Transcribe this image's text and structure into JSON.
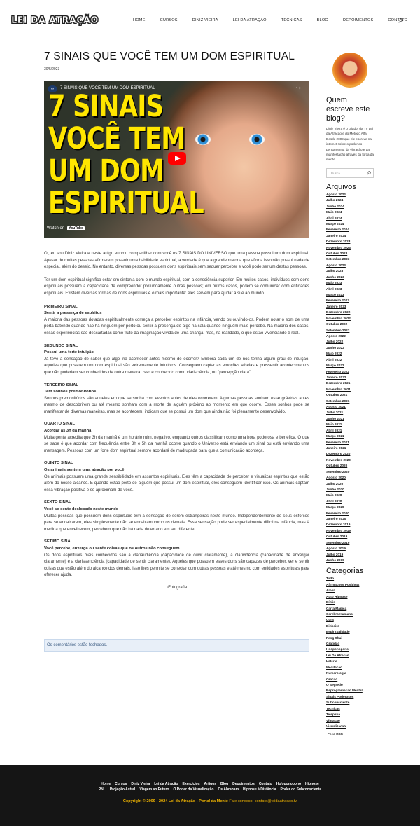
{
  "header": {
    "logo": "LEI DA ATRAÇÃO",
    "nav": [
      "HOME",
      "CURSOS",
      "DINIZ VIEIRA",
      "LEI DA ATRAÇÃO",
      "TECNICAS",
      "BLOG",
      "DEPOIMENTOS",
      "CONTATO",
      "LOGIN"
    ]
  },
  "post": {
    "title": "7 SINAIS QUE VOCÊ TEM UM DOM ESPIRITUAL",
    "date": "30/5/2023",
    "video": {
      "caption": "7 SINAIS QUE VOCÊ TEM UM DOM ESPIRITUAL",
      "overlay": "7 SINAIS VOCÊ TEM UM DOM ESPIRITUAL",
      "watch": "Watch on",
      "brand": "YouTube"
    },
    "intro": "Oi, eu sou Diniz Vieira e neste artigo eu vou compartilhar com você os 7 SINAIS DO UNIVERSO que uma pessoa possui um dom espiritual. Apesar de muitas pessoas afirmarem possuir uma habilidade espiritual, a verdade é que a grande maioria que afirma isso não possui nada de especial, além do desejo. No entanto, diversas pessoas possuem dons espirituais sem sequer perceber e você pode ser um destas pessoas.",
    "p2": "Ter um dom espiritual significa estar em sintonia com o mundo espiritual, com a consciência superior. Em muitos casos, indivíduos com dons espirituais possuem a capacidade de compreender profundamente outras pessoas; em outros casos, podem se comunicar com entidades espirituais. Existem diversas formas de dons espirituais e o mais importante: eles servem para ajudar a si e ao mundo.",
    "sections": [
      {
        "h": "PRIMEIRO SINAL",
        "s": "Sentir a presença de espíritos",
        "t": "A maioria das pessoas dotadas espiritualmente começa a perceber espíritos na infância, vendo ou ouvindo-os. Podem notar o som de uma porta batendo quando não há ninguém por perto ou sentir a presença de algo na sala quando ninguém mais percebe. Na maioria dos casos, essas experiências são descartadas como fruto da imaginação vívida de uma criança, mas, na realidade, o que estão vivenciando é real."
      },
      {
        "h": "SEGUNDO SINAL",
        "s": "Possui uma forte intuição",
        "t": "Já teve a sensação de saber que algo iria acontecer antes mesmo de ocorrer? Embora cada um de nós tenha algum grau de intuição, aqueles que possuem um dom espiritual são extremamente intuitivos. Conseguem captar as emoções alheias e pressentir acontecimentos que não poderiam ser conhecidos de outra maneira. Isso é conhecido como clarisciência, ou \"percepção clara\"."
      },
      {
        "h": "TERCEIRO SINAL",
        "s": "Tem sonhos premonitórios",
        "t": "Sonhos premonitórios são aqueles em que se sonha com eventos antes de eles ocorrerem. Algumas pessoas sonham estar grávidas antes mesmo de descobrirem ou até mesmo sonham com a morte de alguém próximo ao momento em que ocorre. Esses sonhos pode se manifestar de diversas maneiras, mas se acontecem, indicam que se possui um dom que ainda não foi plenamente desenvolvido."
      },
      {
        "h": "QUARTO SINAL",
        "s": "Acordar às 3h da manhã",
        "t": "Muita gente acredita que 3h da manhã é um horário ruim, negativo, enquanto outros classificam como uma hora poderosa e benéfica. O que se sabe é que acordar com frequência entre 3h e 5h da manhã ocorre quando o Universo está enviando um sinal ou está enviando uma mensagem. Pessoas com um forte dom espiritual sempre acordará de madrugada para que a comunicação aconteça."
      },
      {
        "h": "QUINTO SINAL",
        "s": "Os animais sentem uma atração por você",
        "t": "Os animais possuem uma grande sensibilidade em assuntos espirituais. Eles têm a capacidade de perceber e visualizar espíritos que estão além do nosso alcance. E quando estão perto de alguém que possui um dom espiritual, eles conseguem identificar isso. Os animais captam essa vibração positiva e se aproximam de você."
      },
      {
        "h": "SEXTO SINAL",
        "s": "Você se sente deslocado neste mundo",
        "t": "Muitas pessoas que possuem dons espirituais têm a sensação de serem estrangeiras neste mundo. Independentemente de seus esforços para se encaixarem, eles simplesmente não se encaixam como os demais. Essa sensação pode ser especialmente difícil na infância, mas à medida que envelhecem, percebem que não há nada de errado em ser diferente."
      },
      {
        "h": "SÉTIMO SINAL",
        "s": "Você percebe, enxerga ou sente coisas que os outros não conseguem",
        "t": "Os dons espirituais mais conhecidos são a clariaudiência (capacidade de ouvir claramente), a clarividência (capacidade de enxergar claramente) e a clarissenciência (capacidade de sentir claramente). Aqueles que possuem esses dons são capazes de perceber, ver e sentir coisas que estão além do alcance dos demais. Isso lhes permite se conectar com outras pessoas e até mesmo com entidades espirituais para oferecer ajuda."
      }
    ],
    "figure": "Fotografia",
    "comments": "Os comentários estão fechados."
  },
  "sidebar": {
    "about_title": "Quem escreve este blog?",
    "about": "Diniz Vieira é o criador da TV Lei da Atração e do Método Alfa. Desde 2009 que ele escreve na internet sobre o poder do pensamento, da vibração e da manifestação através da força da mente.",
    "search_placeholder": "Busca",
    "archives_title": "Arquivos",
    "archives": [
      "Agosto 2024",
      "Julho 2024",
      "Junho 2024",
      "Maio 2024",
      "Abril 2024",
      "Março 2024",
      "Fevereiro 2024",
      "Janeiro 2024",
      "Dezembro 2023",
      "Novembro 2023",
      "Outubro 2023",
      "Setembro 2023",
      "Agosto 2023",
      "Julho 2023",
      "Junho 2023",
      "Maio 2023",
      "Abril 2023",
      "Março 2023",
      "Fevereiro 2023",
      "Janeiro 2023",
      "Dezembro 2022",
      "Novembro 2022",
      "Outubro 2022",
      "Setembro 2022",
      "Agosto 2022",
      "Julho 2022",
      "Junho 2022",
      "Maio 2022",
      "Abril 2022",
      "Março 2022",
      "Fevereiro 2022",
      "Janeiro 2022",
      "Dezembro 2021",
      "Novembro 2021",
      "Outubro 2021",
      "Setembro 2021",
      "Agosto 2021",
      "Julho 2021",
      "Junho 2021",
      "Maio 2021",
      "Abril 2021",
      "Março 2021",
      "Fevereiro 2021",
      "Janeiro 2021",
      "Dezembro 2020",
      "Novembro 2020",
      "Outubro 2020",
      "Setembro 2020",
      "Agosto 2020",
      "Julho 2020",
      "Junho 2020",
      "Maio 2020",
      "Abril 2020",
      "Março 2020",
      "Fevereiro 2020",
      "Janeiro 2020",
      "Dezembro 2019",
      "Novembro 2019",
      "Outubro 2019",
      "Setembro 2019",
      "Agosto 2019",
      "Julho 2019",
      "Junho 2019"
    ],
    "categories_title": "Categorias",
    "categories": [
      "Tudo",
      "Afirmacoes Positivas",
      "Amor",
      "Auto Hipnose",
      "Bíblia",
      "Carta Magica",
      "Cerebro Humano",
      "Cura",
      "Dinheiro",
      "Espiritualidade",
      "Feng Shui",
      "Gratidao",
      "Hooponopono",
      "Lei Da Atracao",
      "Loteria",
      "Meditacao",
      "Numerologia",
      "Oracao",
      "O Segredo",
      "Reprogramacao Mental",
      "Sinais Poderosos",
      "Subconsciente",
      "Tecnicas",
      "Telepatia",
      "Vibracao",
      "Visualizacao"
    ],
    "feed": "Feed RSS"
  },
  "footer": {
    "row1": [
      "Home",
      "Cursos",
      "Diniz Vieira",
      "Lei da Atração",
      "Exercícios",
      "Artigos",
      "Blog",
      "Depoimentos",
      "Contato",
      "Ho'oponopono",
      "Hipnose"
    ],
    "row2": [
      "PNL",
      "Projeção Astral",
      "Viagem ao Futuro",
      "O Poder da Visualização",
      "Os Abraham",
      "Hipnose à Distância",
      "Poder do Subconsciente"
    ],
    "copyright": "Copyright © 2009 - 2024 Lei da Atração - Portal da Mente",
    "contact": "Fale conosco: contato@leidaatracao.tv"
  }
}
